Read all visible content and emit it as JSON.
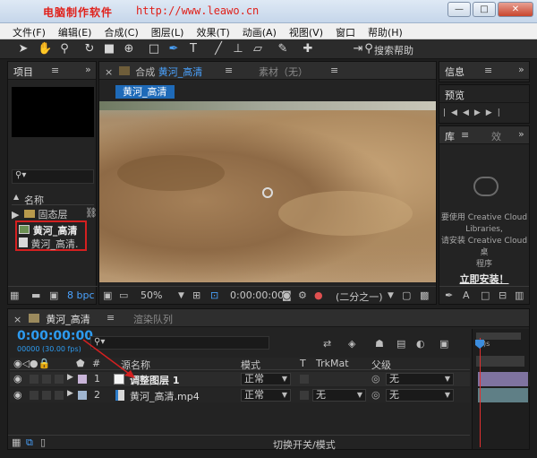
{
  "titlebar": {
    "watermark_cn": "电脑制作软件",
    "watermark_url": "http://www.leawo.cn"
  },
  "menu": [
    "文件(F)",
    "编辑(E)",
    "合成(C)",
    "图层(L)",
    "效果(T)",
    "动画(A)",
    "视图(V)",
    "窗口",
    "帮助(H)"
  ],
  "toolbar": {
    "search_help": "搜索帮助"
  },
  "project": {
    "title": "项目",
    "col_name": "名称",
    "items": [
      {
        "name": "固态层"
      },
      {
        "name": "黄河_高清"
      },
      {
        "name": "黄河_高清."
      }
    ],
    "bpc": "8 bpc"
  },
  "composition": {
    "tab_prefix": "合成",
    "tab_name": "黄河_高清",
    "footage_tab": "素材（无）",
    "breadcrumb": "黄河_高清",
    "zoom": "50%",
    "timecode": "0:00:00:00",
    "resolution": "(二分之一)"
  },
  "info_panel": {
    "title": "信息"
  },
  "preview_panel": {
    "title": "预览"
  },
  "library_panel": {
    "tab": "库",
    "tab2": "效",
    "line1": "要使用 Creative Cloud",
    "line2": "Libraries,",
    "line3": "请安装 Creative Cloud 桌",
    "line4": "程序",
    "install_button": "立即安装！"
  },
  "timeline": {
    "tab": "黄河_高清",
    "render_tab": "渲染队列",
    "timecode": "0:00:00:00",
    "fps": "00000 (30.00 fps)",
    "columns": {
      "num": "#",
      "source": "源名称",
      "mode": "模式",
      "t": "T",
      "trkmat": "TrkMat",
      "parent": "父级"
    },
    "layers": [
      {
        "num": "1",
        "name": "调整图层 1",
        "mode": "正常",
        "trkmat": "",
        "parent": "无",
        "color": "#c8b4d8"
      },
      {
        "num": "2",
        "name": "黄河_高清.mp4",
        "mode": "正常",
        "trkmat": "无",
        "parent": "无",
        "color": "#9fb5d0"
      }
    ],
    "ruler_label": ")s",
    "footer": "切换开关/模式"
  }
}
